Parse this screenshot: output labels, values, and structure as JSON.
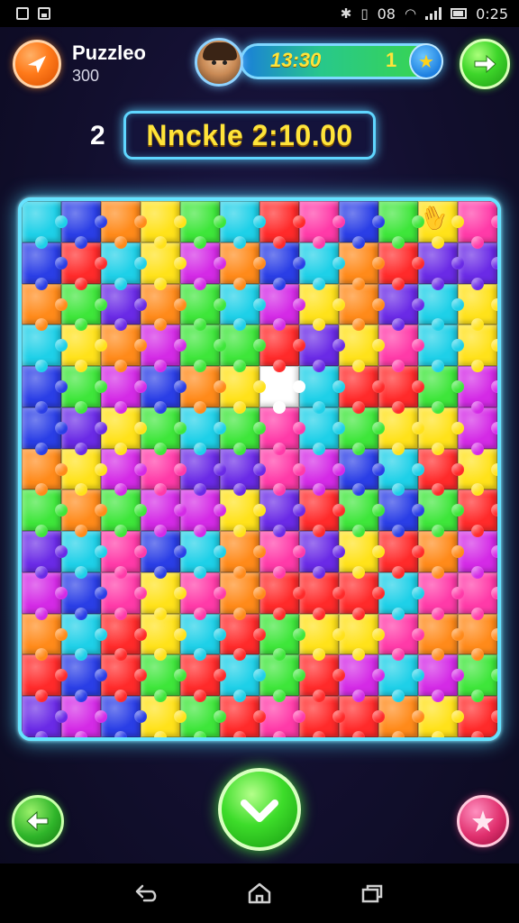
{
  "status_bar": {
    "time": "0:25",
    "indicator": "08",
    "icons": [
      "notification-icon",
      "image-icon",
      "bluetooth-icon",
      "vibrate-icon",
      "wifi-icon",
      "signal-icon",
      "battery-icon"
    ]
  },
  "header": {
    "player_name": "Puzzleo",
    "player_score": "300",
    "timer": "13:30",
    "timer_count": "1",
    "left_button_icon": "plane-icon",
    "right_button_icon": "arrow-right-icon",
    "badge_icon": "star-icon"
  },
  "level": {
    "number": "2",
    "prize": "Nnckle 2:10.00"
  },
  "board": {
    "rows": 13,
    "columns": 12,
    "empty_slot": {
      "row": 4,
      "column": 6
    },
    "piece_colors": [
      "#ff2a2a",
      "#ff8a1a",
      "#ffe21a",
      "#3ee63a",
      "#1ed0e8",
      "#2a3ee6",
      "#d42ae6",
      "#ff3aa8",
      "#6a2ae6"
    ]
  },
  "footer": {
    "back_icon": "arrow-back-icon",
    "confirm_icon": "checkmark-icon",
    "shuffle_icon": "star-pinwheel-icon"
  },
  "nav": {
    "icons": [
      "back-nav-icon",
      "home-nav-icon",
      "recents-nav-icon"
    ]
  }
}
